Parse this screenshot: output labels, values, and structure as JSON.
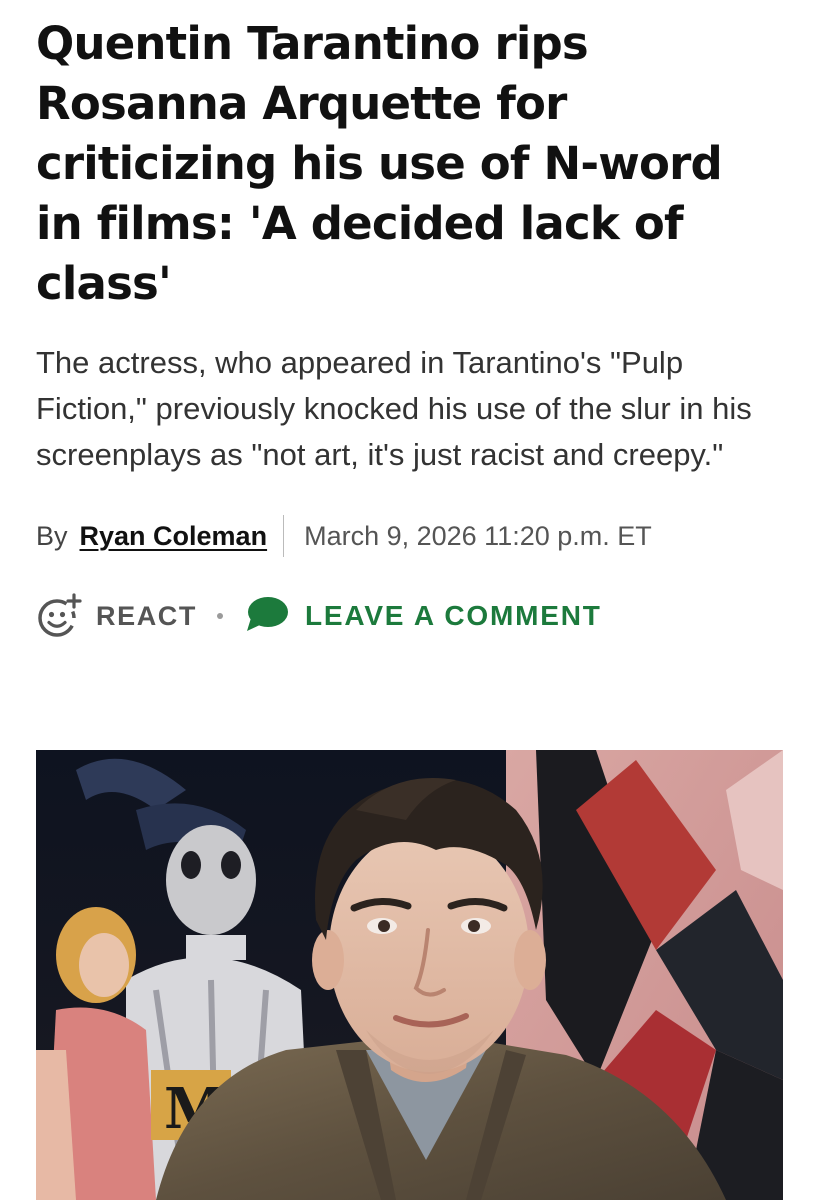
{
  "article": {
    "headline": "Quentin Tarantino rips Rosanna Arquette for criticizing his use of N-word in films: 'A decided lack of class'",
    "dek": "The actress, who appeared in Tarantino's \"Pulp Fiction,\" previously knocked his use of the slur in his screenplays as \"not art, it's just racist and creepy.\"",
    "byline": {
      "prefix": "By",
      "author": "Ryan Coleman",
      "date": "March 9, 2026 11:20 p.m. ET"
    }
  },
  "actions": {
    "react_label": "REACT",
    "react_icon": "smiley-plus-icon",
    "comment_label": "LEAVE A COMMENT",
    "comment_icon": "speech-bubble-icon"
  },
  "hero_image": {
    "lettering": "M"
  },
  "colors": {
    "accent_green": "#1c7a3c",
    "text_primary": "#111111",
    "text_secondary": "#555555"
  }
}
